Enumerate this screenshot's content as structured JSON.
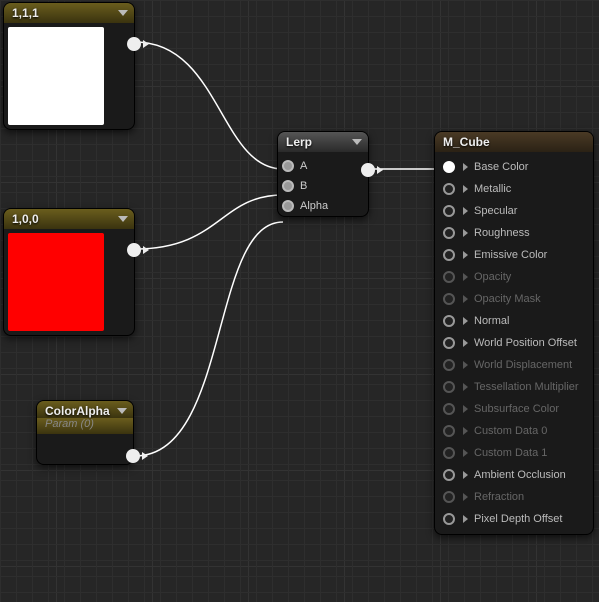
{
  "nodes": {
    "const1": {
      "title": "1,1,1",
      "swatch": "#ffffff"
    },
    "const2": {
      "title": "1,0,0",
      "swatch": "#ff0000"
    },
    "param": {
      "title": "ColorAlpha",
      "subtitle": "Param (0)"
    },
    "lerp": {
      "title": "Lerp",
      "inputs": {
        "a": "A",
        "b": "B",
        "alpha": "Alpha"
      }
    },
    "result": {
      "title": "M_Cube",
      "pins": [
        {
          "label": "Base Color",
          "active": true,
          "connected": true
        },
        {
          "label": "Metallic",
          "active": true,
          "connected": false
        },
        {
          "label": "Specular",
          "active": true,
          "connected": false
        },
        {
          "label": "Roughness",
          "active": true,
          "connected": false
        },
        {
          "label": "Emissive Color",
          "active": true,
          "connected": false
        },
        {
          "label": "Opacity",
          "active": false,
          "connected": false
        },
        {
          "label": "Opacity Mask",
          "active": false,
          "connected": false
        },
        {
          "label": "Normal",
          "active": true,
          "connected": false
        },
        {
          "label": "World Position Offset",
          "active": true,
          "connected": false
        },
        {
          "label": "World Displacement",
          "active": false,
          "connected": false
        },
        {
          "label": "Tessellation Multiplier",
          "active": false,
          "connected": false
        },
        {
          "label": "Subsurface Color",
          "active": false,
          "connected": false
        },
        {
          "label": "Custom Data 0",
          "active": false,
          "connected": false
        },
        {
          "label": "Custom Data 1",
          "active": false,
          "connected": false
        },
        {
          "label": "Ambient Occlusion",
          "active": true,
          "connected": false
        },
        {
          "label": "Refraction",
          "active": false,
          "connected": false
        },
        {
          "label": "Pixel Depth Offset",
          "active": true,
          "connected": false
        }
      ]
    }
  }
}
